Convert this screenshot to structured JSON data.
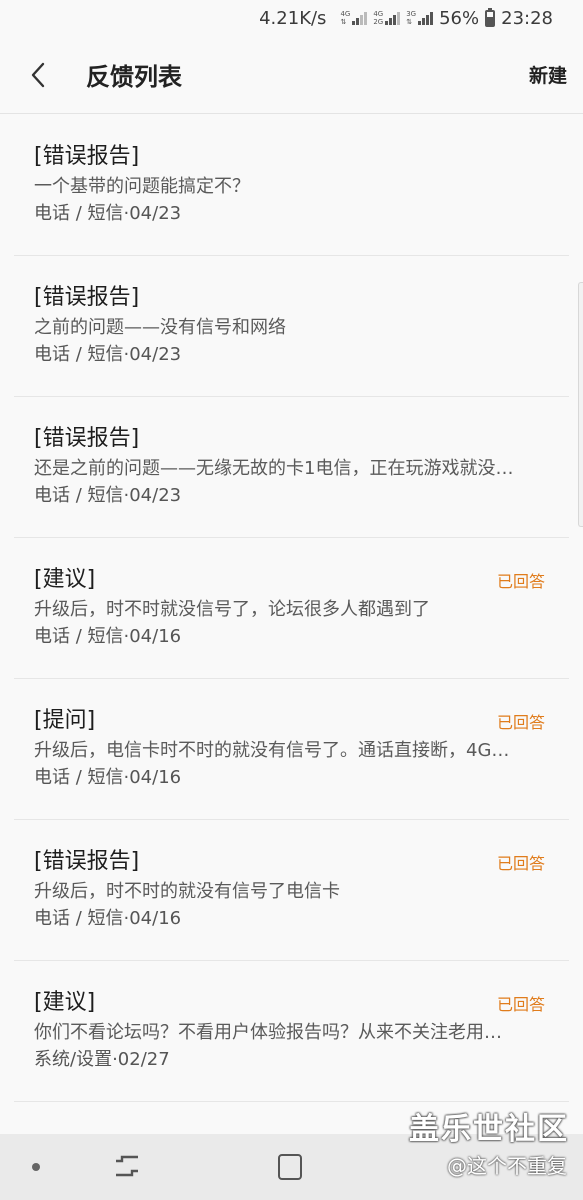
{
  "status_bar": {
    "net_speed": "4.21K/s",
    "net_badge_1_top": "4G",
    "net_badge_2_top": "4G",
    "net_badge_2_bottom": "2G",
    "net_badge_3_top": "3G",
    "battery_percent": "56%",
    "battery_level": 0.56,
    "time": "23:28"
  },
  "header": {
    "title": "反馈列表",
    "new_label": "新建"
  },
  "feedback": [
    {
      "category": "[错误报告]",
      "summary": "一个基带的问题能搞定不？",
      "meta": "电话 / 短信·04/23",
      "status": ""
    },
    {
      "category": "[错误报告]",
      "summary": "之前的问题——没有信号和网络",
      "meta": "电话 / 短信·04/23",
      "status": ""
    },
    {
      "category": "[错误报告]",
      "summary": "还是之前的问题——无缘无故的卡1电信，正在玩游戏就没…",
      "meta": "电话 / 短信·04/23",
      "status": ""
    },
    {
      "category": "[建议]",
      "summary": "升级后，时不时就没信号了，论坛很多人都遇到了",
      "meta": "电话 / 短信·04/16",
      "status": "已回答"
    },
    {
      "category": "[提问]",
      "summary": "升级后，电信卡时不时的就没有信号了。通话直接断，4G…",
      "meta": "电话 / 短信·04/16",
      "status": "已回答"
    },
    {
      "category": "[错误报告]",
      "summary": "升级后，时不时的就没有信号了电信卡",
      "meta": "电话 / 短信·04/16",
      "status": "已回答"
    },
    {
      "category": "[建议]",
      "summary": "你们不看论坛吗？不看用户体验报告吗？从来不关注老用…",
      "meta": "系统/设置·02/27",
      "status": "已回答"
    }
  ],
  "watermark": {
    "title": "盖乐世社区",
    "user": "@这个不重复"
  },
  "icons": {
    "back": "back-arrow-icon",
    "recents": "recents-icon",
    "home": "home-icon",
    "dot": "dot-icon"
  }
}
